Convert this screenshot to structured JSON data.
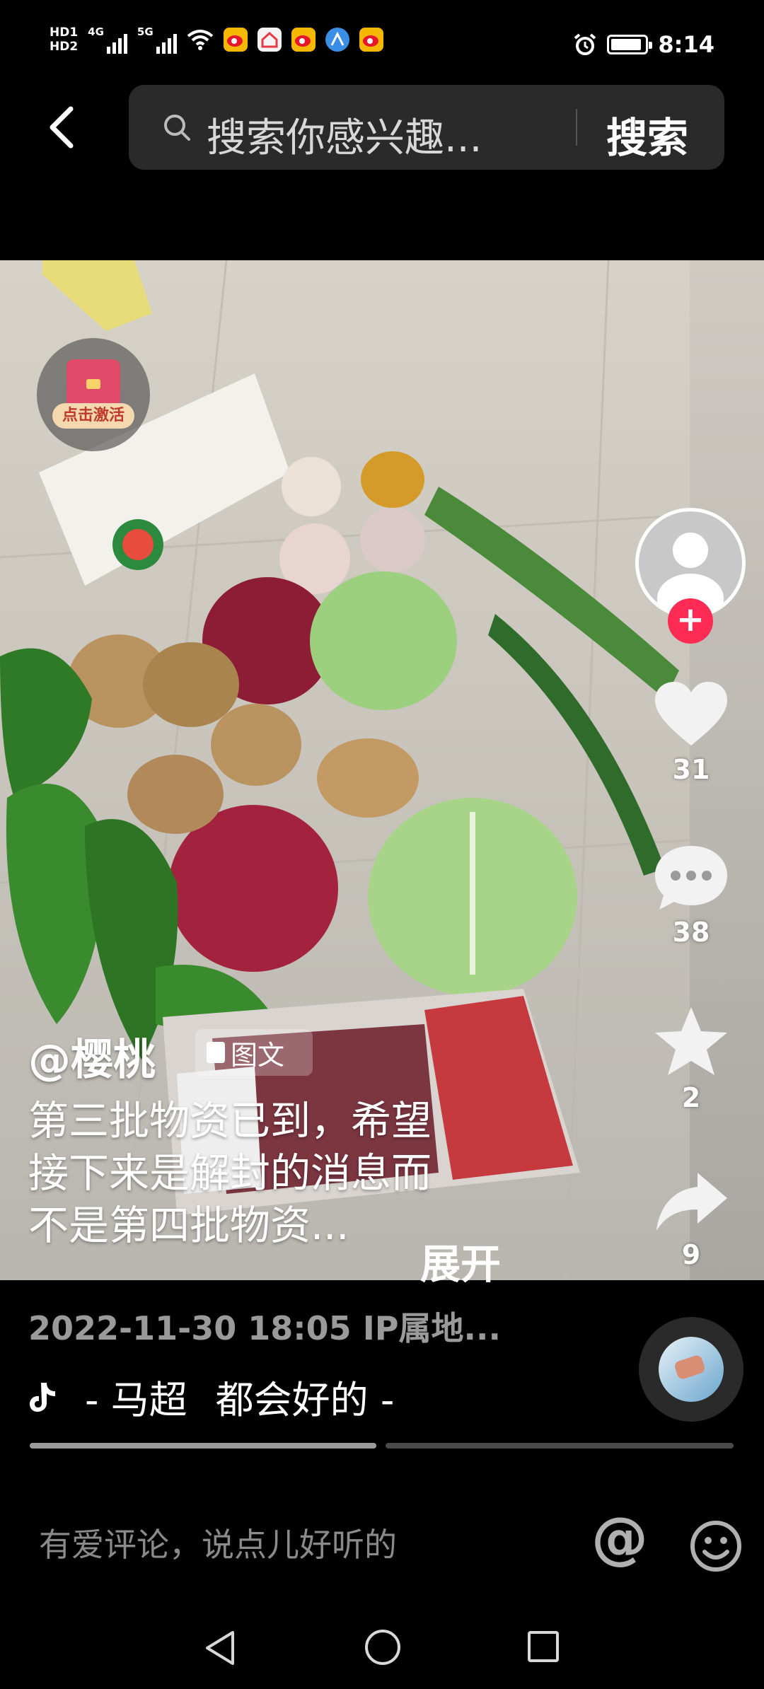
{
  "status_bar": {
    "hd1": "HD1",
    "hd2": "HD2",
    "net1": "4G",
    "net2": "5G",
    "time": "8:14",
    "battery_level": 0.9,
    "icons": [
      "signal-icon",
      "signal-icon",
      "wifi-icon",
      "weibo-icon",
      "home-app-icon",
      "weibo-icon",
      "browser-icon",
      "weibo-icon",
      "alarm-icon",
      "battery-icon"
    ]
  },
  "search": {
    "placeholder": "搜索你感兴趣...",
    "button": "搜索"
  },
  "activate_badge": {
    "label": "点击激活"
  },
  "actions": {
    "follow_symbol": "+",
    "likes": "31",
    "comments": "38",
    "favorites": "2",
    "shares": "9"
  },
  "post": {
    "author": "@樱桃",
    "type_tag": "图文",
    "caption_line1": "第三批物资已到，希望",
    "caption_line2": "接下来是解封的消息而",
    "caption_line3": "不是第四批物资...",
    "expand": "展开",
    "meta": "2022-11-30 18:05  IP属地...",
    "music_artist": "- 马超",
    "music_title": "都会好的 -"
  },
  "progress": [
    {
      "fill": 1.0
    },
    {
      "fill": 0.0
    }
  ],
  "comment_bar": {
    "placeholder": "有爱评论，说点儿好听的",
    "at": "@"
  },
  "colors": {
    "accent": "#fe2c55",
    "background": "#000000"
  }
}
